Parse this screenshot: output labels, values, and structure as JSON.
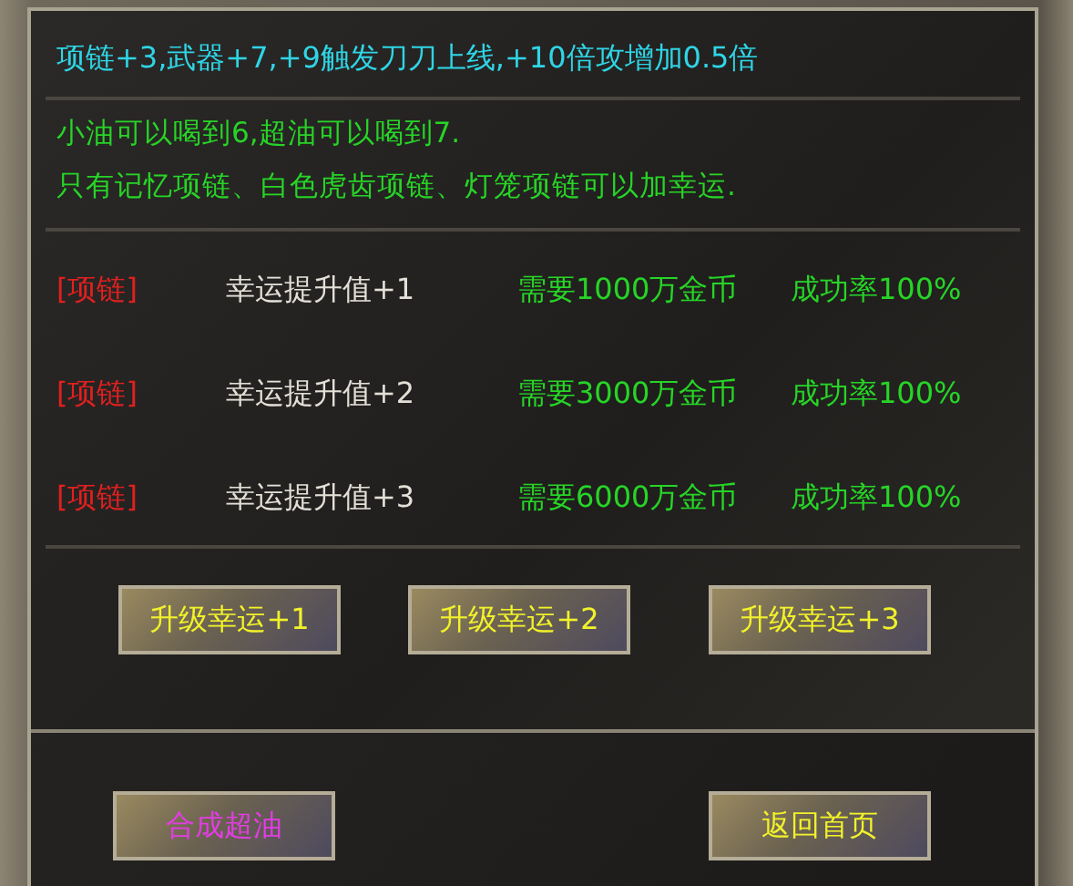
{
  "header": "项链+3,武器+7,+9触发刀刀上线,+10倍攻增加0.5倍",
  "notes": [
    "小油可以喝到6,超油可以喝到7.",
    "只有记忆项链、白色虎齿项链、灯笼项链可以加幸运."
  ],
  "upgrades": [
    {
      "tag": "[项链]",
      "label": "幸运提升值+1",
      "cost": "需要1000万金币",
      "rate": "成功率100%"
    },
    {
      "tag": "[项链]",
      "label": "幸运提升值+2",
      "cost": "需要3000万金币",
      "rate": "成功率100%"
    },
    {
      "tag": "[项链]",
      "label": "幸运提升值+3",
      "cost": "需要6000万金币",
      "rate": "成功率100%"
    }
  ],
  "upgrade_buttons": [
    "升级幸运+1",
    "升级幸运+2",
    "升级幸运+3"
  ],
  "bottom_buttons": [
    {
      "label": "合成超油",
      "kind": "special"
    },
    {
      "label": "返回首页",
      "kind": "normal"
    }
  ]
}
